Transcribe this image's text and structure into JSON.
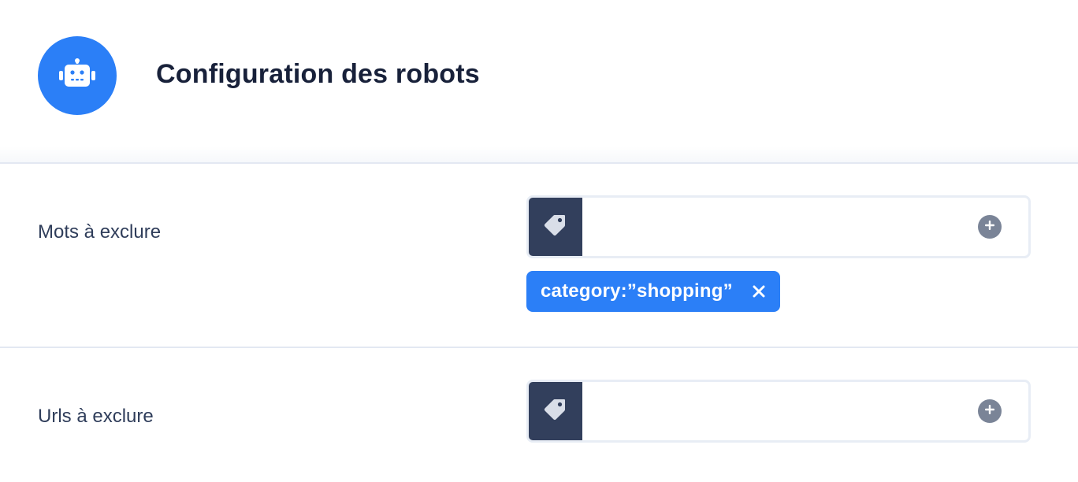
{
  "header": {
    "title": "Configuration des robots",
    "icon": "robot-icon",
    "accent_color": "#2b7ff7"
  },
  "rows": [
    {
      "label": "Mots à exclure",
      "input": {
        "value": "",
        "placeholder": "",
        "leading_icon": "tag-icon",
        "action_icon": "plus-circle-icon"
      },
      "chips": [
        {
          "label": "category:”shopping”",
          "remove_icon": "close-icon"
        }
      ]
    },
    {
      "label": "Urls à exclure",
      "input": {
        "value": "",
        "placeholder": "",
        "leading_icon": "tag-icon",
        "action_icon": "plus-circle-icon"
      },
      "chips": []
    }
  ],
  "colors": {
    "icon_box": "#323f5c",
    "chip": "#2b7ff7",
    "add_button": "#7a8497"
  }
}
